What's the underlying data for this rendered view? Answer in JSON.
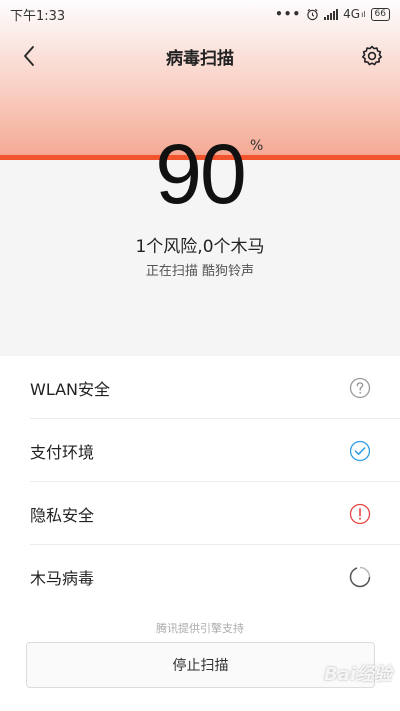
{
  "status_bar": {
    "time": "下午1:33",
    "dots": "•••",
    "network": "4G",
    "network_sup": "ıl",
    "battery": "66"
  },
  "header": {
    "title": "病毒扫描"
  },
  "scan": {
    "percent": "90",
    "percent_sign": "%",
    "progress": 0.9,
    "risk_summary": "1个风险,0个木马",
    "status": "正在扫描 酷狗铃声"
  },
  "list": {
    "items": [
      {
        "label": "WLAN安全",
        "state": "question-icon"
      },
      {
        "label": "支付环境",
        "state": "check-icon"
      },
      {
        "label": "隐私安全",
        "state": "warning-icon"
      },
      {
        "label": "木马病毒",
        "state": "loading-icon"
      }
    ]
  },
  "footer": {
    "powered_by": "腾讯提供引擎支持",
    "stop_label": "停止扫描"
  },
  "watermark": "Bai经验",
  "colors": {
    "accent": "#f2542d",
    "check": "#2e9be6",
    "warning": "#e84545",
    "neutral_icon": "#999999"
  }
}
